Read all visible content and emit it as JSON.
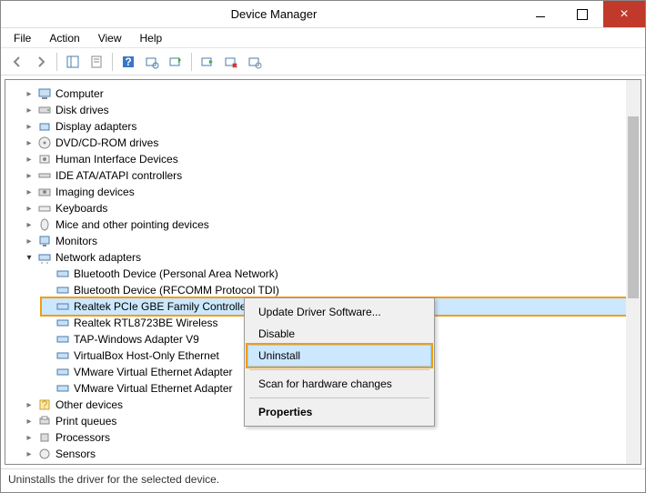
{
  "window": {
    "title": "Device Manager"
  },
  "menu": {
    "file": "File",
    "action": "Action",
    "view": "View",
    "help": "Help"
  },
  "tree": {
    "items": [
      "Computer",
      "Disk drives",
      "Display adapters",
      "DVD/CD-ROM drives",
      "Human Interface Devices",
      "IDE ATA/ATAPI controllers",
      "Imaging devices",
      "Keyboards",
      "Mice and other pointing devices",
      "Monitors"
    ],
    "expanded_label": "Network adapters",
    "network_items": [
      "Bluetooth Device (Personal Area Network)",
      "Bluetooth Device (RFCOMM Protocol TDI)",
      "Realtek PCIe GBE Family Controller",
      "Realtek RTL8723BE Wireless",
      "TAP-Windows Adapter V9",
      "VirtualBox Host-Only Ethernet",
      "VMware Virtual Ethernet Adapter",
      "VMware Virtual Ethernet Adapter"
    ],
    "after_items": [
      "Other devices",
      "Print queues",
      "Processors",
      "Sensors"
    ]
  },
  "context": {
    "update": "Update Driver Software...",
    "disable": "Disable",
    "uninstall": "Uninstall",
    "scan": "Scan for hardware changes",
    "properties": "Properties"
  },
  "status": {
    "text": "Uninstalls the driver for the selected device."
  }
}
